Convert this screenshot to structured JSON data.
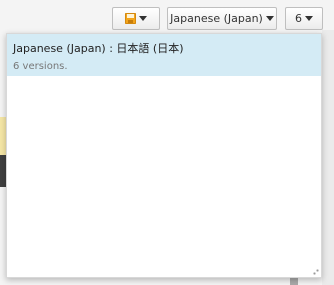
{
  "toolbar": {
    "save_icon": "save-icon",
    "language_label": "Japanese (Japan)",
    "version_label": "6"
  },
  "dropdown": {
    "items": [
      {
        "title": "Japanese (Japan) : 日本語 (日本)",
        "subtitle": "6 versions."
      }
    ]
  },
  "colors": {
    "selected_item_bg": "#d4ebf5",
    "save_icon": "#f3a51b"
  }
}
